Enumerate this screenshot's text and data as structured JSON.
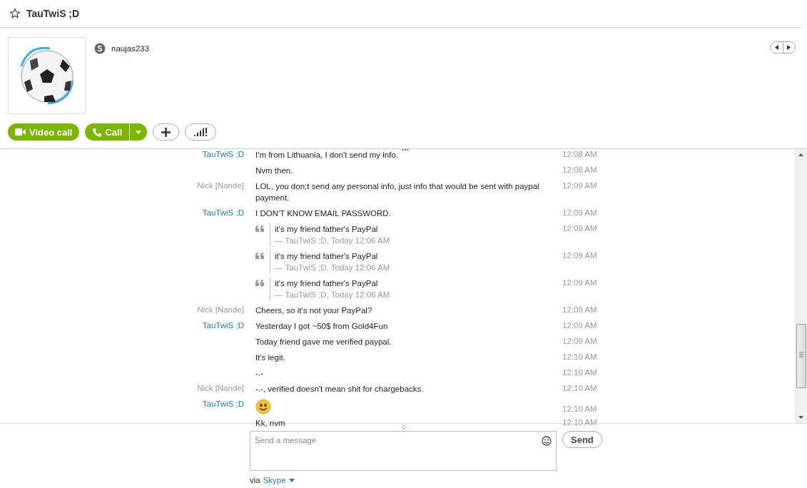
{
  "window": {
    "title": "TauTwiS ;D",
    "favorite": false
  },
  "profile": {
    "username": "naujas233"
  },
  "actions": {
    "video_call": "Video call",
    "call": "Call"
  },
  "messages": [
    {
      "kind": "text",
      "sender": "TauTwiS ;D",
      "color": "#1a7ac8",
      "text": "I'm from Lithuania, I don't send my info.",
      "time": "12:08 AM"
    },
    {
      "kind": "text",
      "text": "Nvm then.",
      "time": "12:08 AM"
    },
    {
      "kind": "text",
      "sender": "Nick [Nande]",
      "color": "#9a9a9a",
      "text": "LOL, you don;t send any personal info, just info that would be sent with paypal payment.",
      "time": "12:09 AM"
    },
    {
      "kind": "text",
      "sender": "TauTwiS ;D",
      "color": "#1a7ac8",
      "text": "I DON'T KNOW EMAIL PASSWORD.",
      "time": "12:09 AM"
    },
    {
      "kind": "quote",
      "text": "it's my friend father's PayPal",
      "source": "— TauTwiS ;D, Today 12:06 AM",
      "time": "12:09 AM"
    },
    {
      "kind": "quote",
      "text": "it's my friend father's PayPal",
      "source": "— TauTwiS ;D, Today 12:06 AM",
      "time": "12:09 AM"
    },
    {
      "kind": "quote",
      "text": "it's my friend father's PayPal",
      "source": "— TauTwiS ;D, Today 12:06 AM",
      "time": "12:09 AM"
    },
    {
      "kind": "text",
      "sender": "Nick [Nande]",
      "color": "#9a9a9a",
      "text": "Cheers, so it's not your PayPal?",
      "time": "12:09 AM"
    },
    {
      "kind": "text",
      "sender": "TauTwiS ;D",
      "color": "#1a7ac8",
      "text": "Yesterday I got ~50$ from Gold4Fun",
      "time": "12:09 AM"
    },
    {
      "kind": "text",
      "text": "Today friend gave me verified paypal.",
      "time": "12:09 AM"
    },
    {
      "kind": "text",
      "text": "It's legit.",
      "time": "12:10 AM"
    },
    {
      "kind": "text",
      "text": "-.-",
      "time": "12:10 AM"
    },
    {
      "kind": "text",
      "sender": "Nick [Nande]",
      "color": "#9a9a9a",
      "text": "-.-, verified doesn't mean shit for chargebacks.",
      "time": "12:10 AM"
    },
    {
      "kind": "emoji",
      "sender": "TauTwiS ;D",
      "color": "#1a7ac8",
      "time": "12:10 AM"
    },
    {
      "kind": "text",
      "text": "Kk, nvm",
      "time": "12:10 AM"
    }
  ],
  "composer": {
    "placeholder": "Send a message",
    "send": "Send"
  },
  "via": {
    "label": "via",
    "service": "Skype"
  }
}
